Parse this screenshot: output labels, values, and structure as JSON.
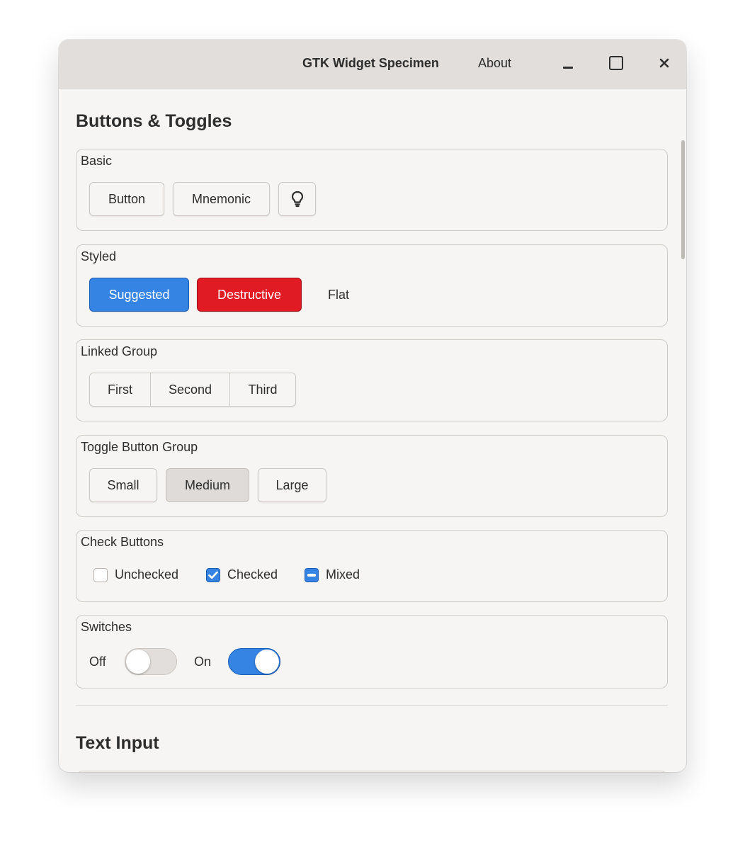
{
  "window": {
    "title": "GTK Widget Specimen",
    "about_label": "About",
    "minimize_icon": "minimize-icon",
    "maximize_icon": "maximize-icon",
    "close_icon": "close-icon",
    "close_glyph": "✕"
  },
  "sections": {
    "buttons_toggles": {
      "title": "Buttons & Toggles"
    },
    "text_input": {
      "title": "Text Input"
    }
  },
  "basic": {
    "label": "Basic",
    "button": "Button",
    "mnemonic": "Mnemonic",
    "icon_button": "lightbulb-icon"
  },
  "styled": {
    "label": "Styled",
    "suggested": "Suggested",
    "destructive": "Destructive",
    "flat": "Flat"
  },
  "linked_group": {
    "label": "Linked Group",
    "first": "First",
    "second": "Second",
    "third": "Third"
  },
  "toggle_group": {
    "label": "Toggle Button Group",
    "small": "Small",
    "medium": "Medium",
    "large": "Large",
    "selected": "Medium"
  },
  "check_buttons": {
    "label": "Check Buttons",
    "unchecked": "Unchecked",
    "checked": "Checked",
    "mixed": "Mixed"
  },
  "switches": {
    "label": "Switches",
    "off_label": "Off",
    "on_label": "On",
    "off_state": false,
    "on_state": true
  },
  "colors": {
    "accent": "#3584e4",
    "destructive": "#e01b24"
  }
}
